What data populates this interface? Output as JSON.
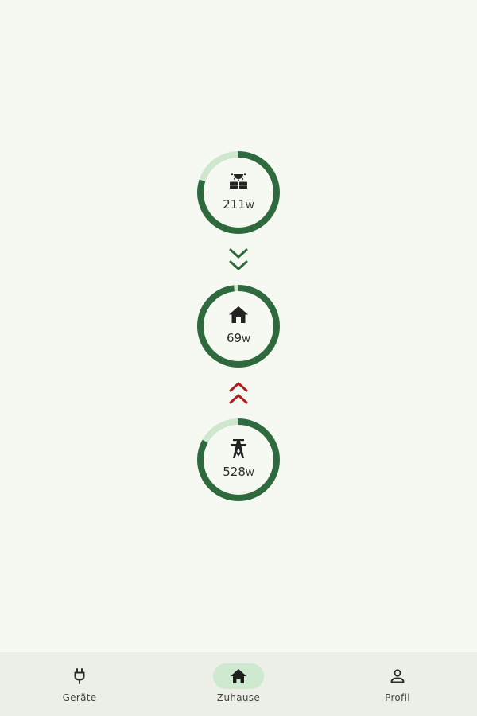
{
  "colors": {
    "background": "#f5f9f1",
    "ring_fill": "#2e6a3e",
    "ring_track": "#cfe6cf",
    "arrow_down": "#2e6a3e",
    "arrow_up": "#b3191c",
    "nav_background": "#ecefe8",
    "nav_active_pill": "#cfe8d0"
  },
  "gauges": {
    "solar": {
      "icon": "solar-panel-icon",
      "value": "211",
      "unit": "W",
      "fill_fraction": 0.8
    },
    "home": {
      "icon": "home-icon",
      "value": "69",
      "unit": "W",
      "fill_fraction": 0.98
    },
    "grid": {
      "icon": "power-pylon-icon",
      "value": "528",
      "unit": "W",
      "fill_fraction": 0.83
    }
  },
  "flows": {
    "solar_to_home": {
      "icon": "double-chevron-down-icon",
      "direction": "down"
    },
    "grid_to_home": {
      "icon": "double-chevron-up-icon",
      "direction": "up"
    }
  },
  "nav": {
    "items": [
      {
        "label": "Geräte",
        "icon": "plug-icon",
        "active": false
      },
      {
        "label": "Zuhause",
        "icon": "home-icon",
        "active": true
      },
      {
        "label": "Profil",
        "icon": "person-icon",
        "active": false
      }
    ]
  }
}
